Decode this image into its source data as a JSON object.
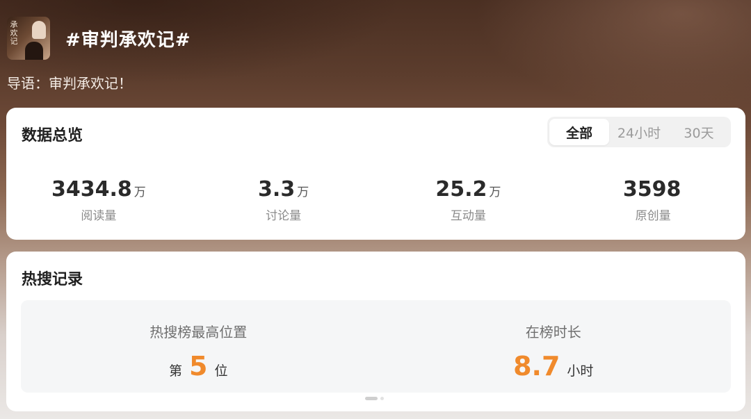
{
  "header": {
    "cover_icon": "topic-cover-image",
    "cover_text": "承欢记",
    "title": "#审判承欢记#"
  },
  "intro": "导语：审判承欢记！",
  "overview": {
    "title": "数据总览",
    "tabs": [
      {
        "label": "全部",
        "active": true
      },
      {
        "label": "24小时",
        "active": false
      },
      {
        "label": "30天",
        "active": false
      }
    ],
    "stats": [
      {
        "value": "3434.8",
        "unit": "万",
        "label": "阅读量"
      },
      {
        "value": "3.3",
        "unit": "万",
        "label": "讨论量"
      },
      {
        "value": "25.2",
        "unit": "万",
        "label": "互动量"
      },
      {
        "value": "3598",
        "unit": "",
        "label": "原创量"
      }
    ]
  },
  "hot": {
    "title": "热搜记录",
    "peak": {
      "label": "热搜榜最高位置",
      "prefix": "第",
      "value": "5",
      "suffix": "位"
    },
    "duration": {
      "label": "在榜时长",
      "value": "8.7",
      "suffix": "小时"
    },
    "accent_color": "#f08a2c",
    "pager": {
      "pages": 2,
      "current": 1
    }
  }
}
